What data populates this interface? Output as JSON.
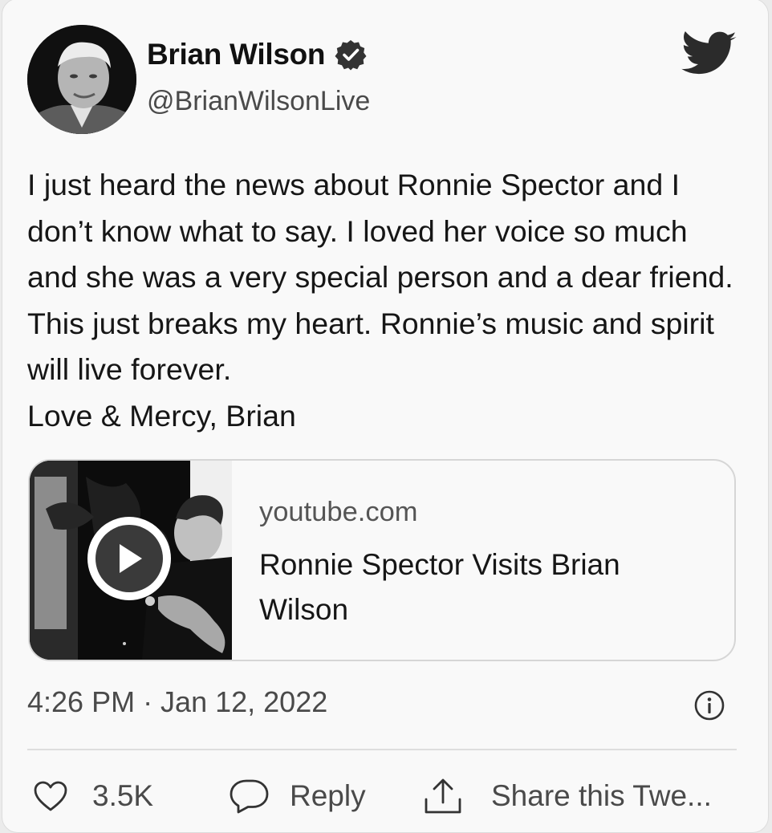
{
  "author": {
    "display_name": "Brian Wilson",
    "handle": "@BrianWilsonLive",
    "verified": true,
    "avatar_icon": "avatar-photo"
  },
  "tweet": {
    "text": "I just heard the news about Ronnie Spector and I don’t know what to say. I loved her voice so much and she was a very special person and a dear friend. This just breaks my heart. Ronnie’s music and spirit will live forever.\nLove & Mercy, Brian",
    "timestamp": "4:26 PM · Jan 12, 2022"
  },
  "link_card": {
    "domain": "youtube.com",
    "title": "Ronnie Spector Visits Brian Wilson",
    "thumbnail_icon": "video-thumbnail",
    "play_icon": "play-icon"
  },
  "actions": {
    "like_count": "3.5K",
    "reply_label": "Reply",
    "share_label": "Share this Twe..."
  },
  "icons": {
    "brand": "twitter-bird-icon",
    "verified": "verified-badge-icon",
    "info": "info-icon",
    "like": "heart-icon",
    "reply": "speech-bubble-icon",
    "share": "share-icon"
  },
  "colors": {
    "background": "#f9f9f9",
    "text": "#151515",
    "secondary_text": "#4a4a4a",
    "border": "#d6d6d6"
  }
}
